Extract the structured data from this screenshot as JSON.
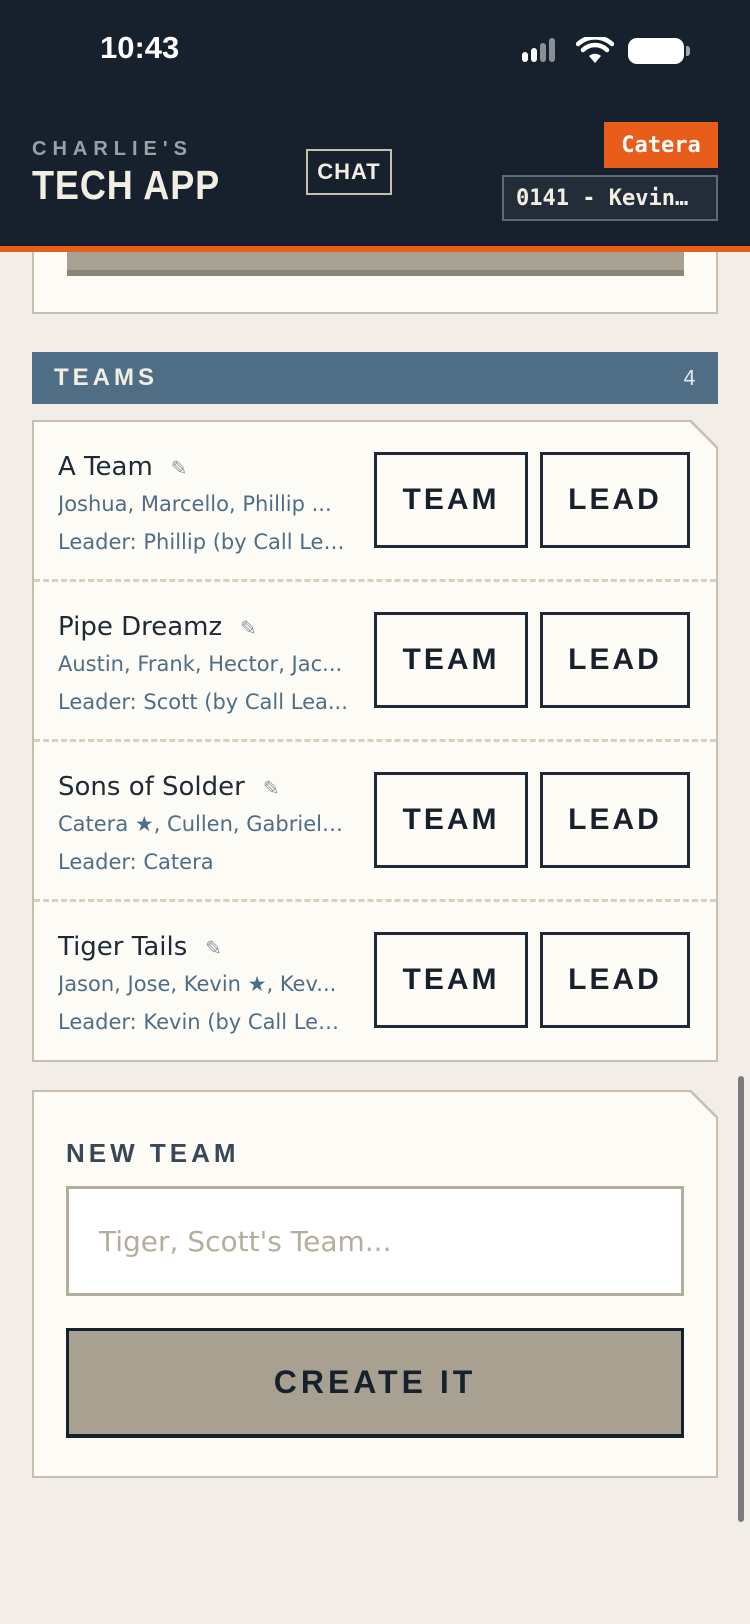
{
  "status_bar": {
    "time": "10:43"
  },
  "header": {
    "brand_top": "CHARLIE'S",
    "brand_main": "TECH APP",
    "chat_label": "CHAT",
    "user_name": "Catera",
    "site_label": "0141 - Kevin…"
  },
  "teams": {
    "title": "TEAMS",
    "count": "4",
    "items": [
      {
        "name": "A Team",
        "members": "Joshua, Marcello, Phillip ...",
        "leader": "Leader: Phillip (by Call Lea...",
        "team_label": "TEAM",
        "lead_label": "LEAD"
      },
      {
        "name": "Pipe Dreamz",
        "members": "Austin, Frank, Hector, Jac...",
        "leader": "Leader: Scott (by Call Lea...",
        "team_label": "TEAM",
        "lead_label": "LEAD"
      },
      {
        "name": "Sons of Solder",
        "members": "Catera ★, Cullen, Gabriel, ...",
        "leader": "Leader: Catera",
        "team_label": "TEAM",
        "lead_label": "LEAD"
      },
      {
        "name": "Tiger Tails",
        "members": "Jason, Jose, Kevin ★, Kev...",
        "leader": "Leader: Kevin (by Call Lea...",
        "team_label": "TEAM",
        "lead_label": "LEAD"
      }
    ]
  },
  "new_team": {
    "label": "NEW TEAM",
    "placeholder": "Tiger, Scott's Team...",
    "value": "",
    "button_label": "CREATE IT"
  },
  "icons": {
    "edit": "pencil-icon",
    "signal": "cellular-signal-icon",
    "wifi": "wifi-icon",
    "battery": "battery-icon"
  },
  "colors": {
    "header_bg": "#17212d",
    "accent_orange": "#e85d1a",
    "teams_header_bg": "#4f6e85",
    "page_bg": "#f2ede6",
    "card_bg": "#fdfbf6",
    "create_button_bg": "#a8a192"
  }
}
